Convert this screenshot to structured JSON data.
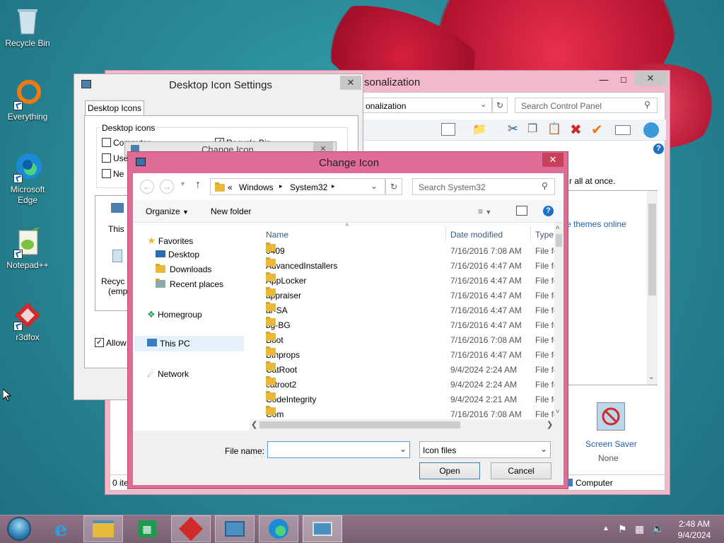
{
  "desktop": {
    "icons": [
      {
        "label": "Recycle Bin",
        "icon": "recycle-bin-icon"
      },
      {
        "label": "Everything",
        "icon": "everything-icon"
      },
      {
        "label": "Microsoft Edge",
        "icon": "edge-icon"
      },
      {
        "label": "Notepad++",
        "icon": "notepadpp-icon"
      },
      {
        "label": "r3dfox",
        "icon": "r3dfox-icon"
      }
    ]
  },
  "personalization": {
    "title": "sonalization",
    "address": "onalization",
    "search_placeholder": "Search Control Panel",
    "text_all_at_once": "r all at once.",
    "themes_link": "re themes online",
    "screen_saver_label": "Screen Saver",
    "screen_saver_value": "None",
    "status_left": "0 ite",
    "status_right": "Computer"
  },
  "desktop_icon_settings": {
    "title": "Desktop Icon Settings",
    "tab": "Desktop Icons",
    "group": "Desktop icons",
    "cb_computer": "Computer",
    "cb_recycle": "Recycle Bin",
    "cb_user": "Use",
    "cb_network": "Ne",
    "preview_this": "This",
    "preview_recycle": "Recyc",
    "preview_recycle2": "(emp",
    "allow_label": "Allow"
  },
  "change_icon_behind": {
    "title": "Change Icon"
  },
  "change_icon": {
    "title": "Change Icon",
    "breadcrumb": [
      "«",
      "Windows",
      "System32"
    ],
    "search_placeholder": "Search System32",
    "organize": "Organize",
    "new_folder": "New folder",
    "nav": {
      "favorites": "Favorites",
      "desktop": "Desktop",
      "downloads": "Downloads",
      "recent": "Recent places",
      "homegroup": "Homegroup",
      "thispc": "This PC",
      "network": "Network"
    },
    "columns": {
      "name": "Name",
      "date": "Date modified",
      "type": "Type"
    },
    "files": [
      {
        "name": "0409",
        "date": "7/16/2016 7:08 AM",
        "type": "File fol"
      },
      {
        "name": "AdvancedInstallers",
        "date": "7/16/2016 4:47 AM",
        "type": "File fol"
      },
      {
        "name": "AppLocker",
        "date": "7/16/2016 4:47 AM",
        "type": "File fol"
      },
      {
        "name": "appraiser",
        "date": "7/16/2016 4:47 AM",
        "type": "File fol"
      },
      {
        "name": "ar-SA",
        "date": "7/16/2016 4:47 AM",
        "type": "File fol"
      },
      {
        "name": "bg-BG",
        "date": "7/16/2016 4:47 AM",
        "type": "File fol"
      },
      {
        "name": "Boot",
        "date": "7/16/2016 7:08 AM",
        "type": "File fol"
      },
      {
        "name": "Bthprops",
        "date": "7/16/2016 4:47 AM",
        "type": "File fol"
      },
      {
        "name": "CatRoot",
        "date": "9/4/2024 2:24 AM",
        "type": "File fol"
      },
      {
        "name": "catroot2",
        "date": "9/4/2024 2:24 AM",
        "type": "File fol"
      },
      {
        "name": "CodeIntegrity",
        "date": "9/4/2024 2:21 AM",
        "type": "File fol"
      },
      {
        "name": "Com",
        "date": "7/16/2016 7:08 AM",
        "type": "File fol"
      }
    ],
    "filename_label": "File name:",
    "filename_value": "",
    "filetype": "Icon files",
    "open": "Open",
    "cancel": "Cancel"
  },
  "taskbar": {
    "time": "2:48 AM",
    "date": "9/4/2024"
  },
  "colors": {
    "change_icon_frame": "#e06b96",
    "close_red": "#c7415a",
    "link_blue": "#1f5fb5"
  }
}
